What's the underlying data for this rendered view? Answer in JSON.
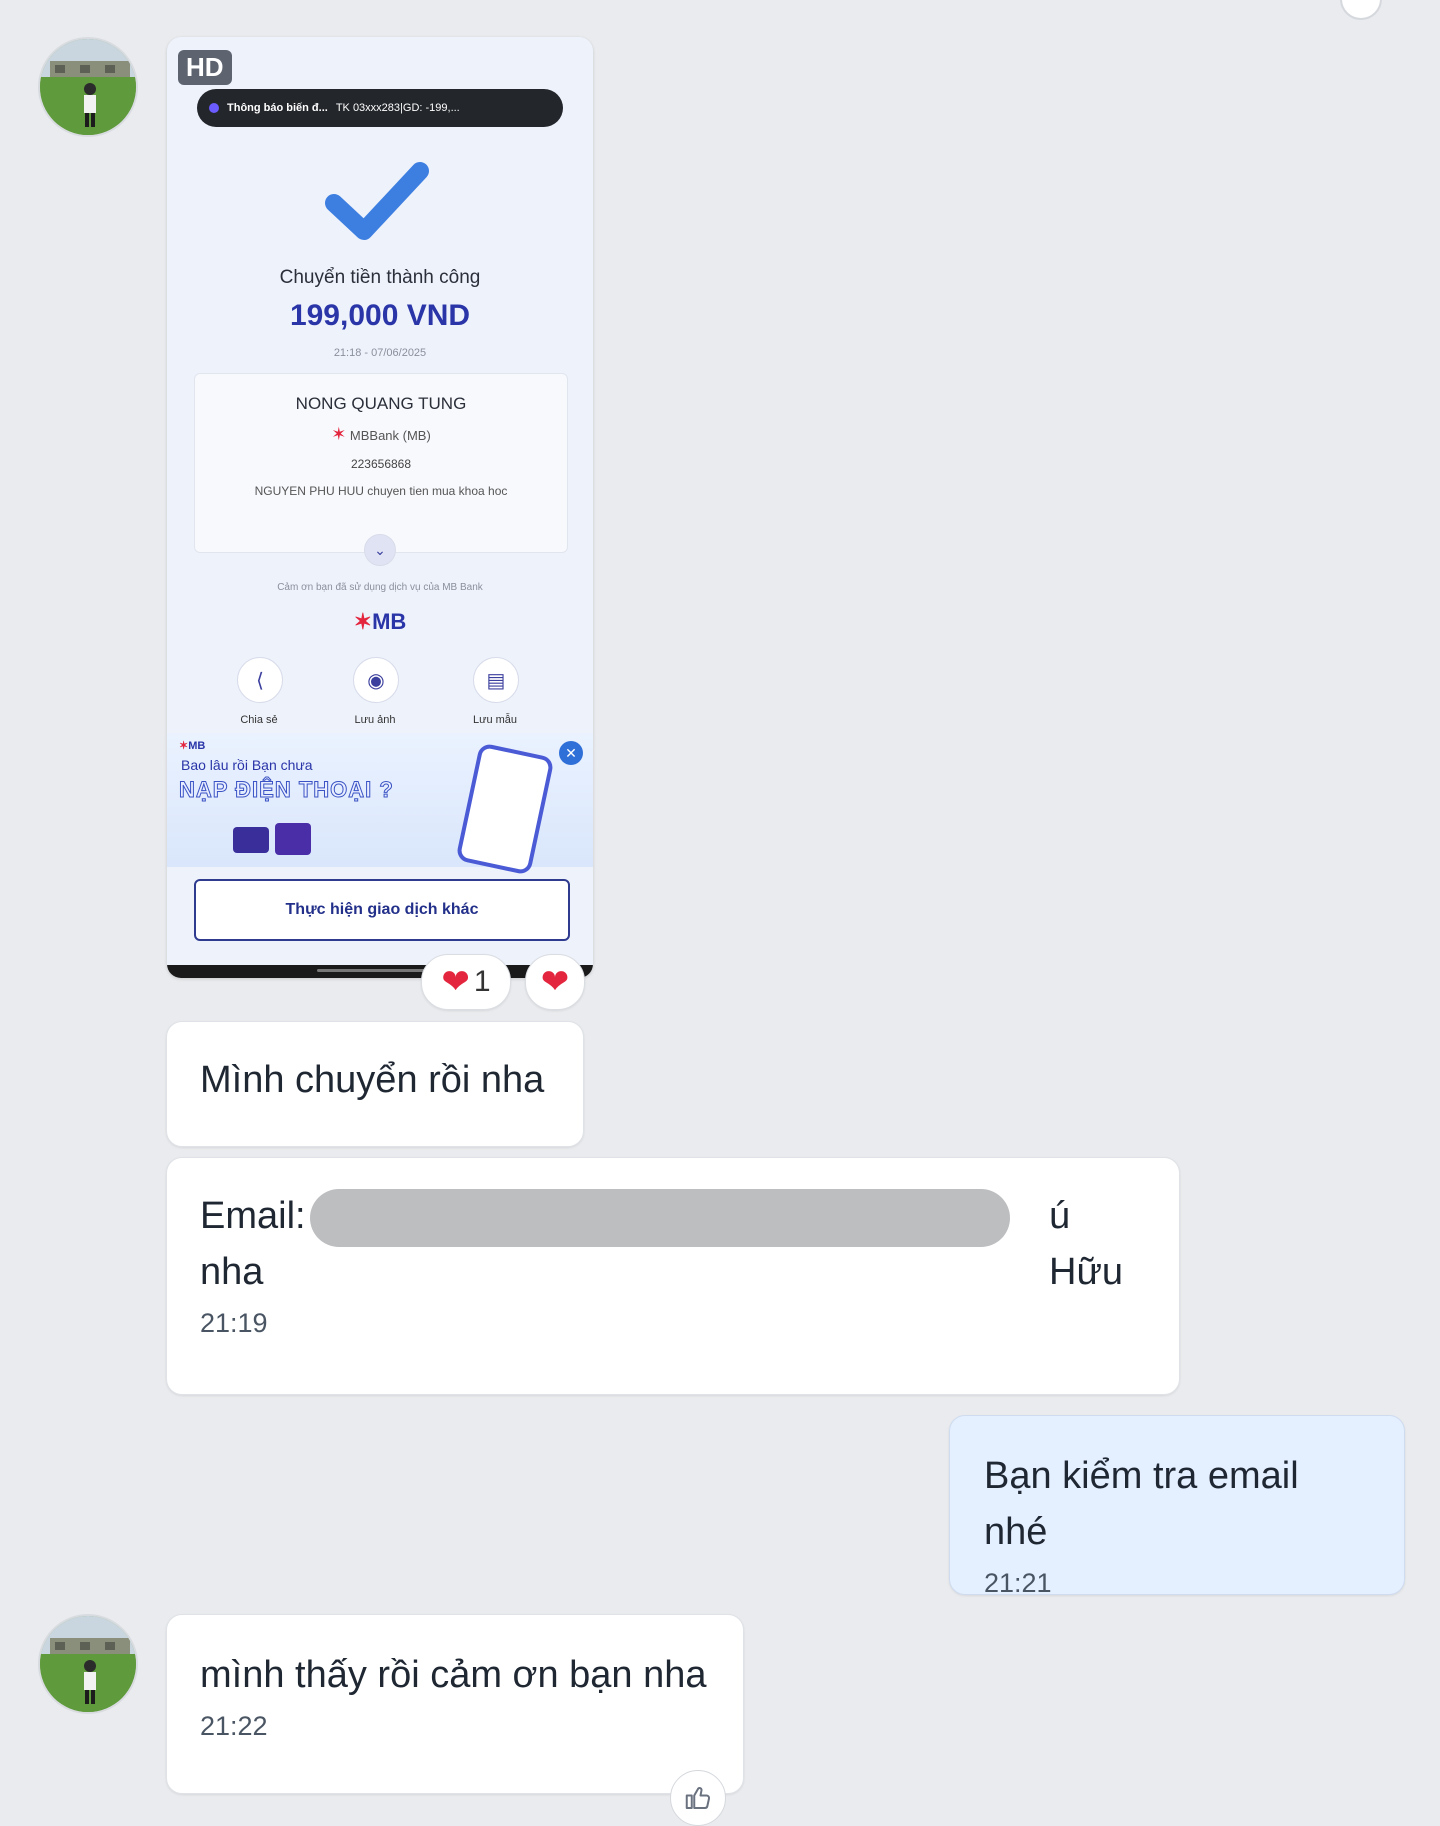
{
  "attachment": {
    "hd_badge": "HD",
    "notification_title": "Thông báo biến đ...",
    "notification_body": "TK 03xxx283|GD: -199,...",
    "success_title": "Chuyển tiền thành công",
    "amount": "199,000 VND",
    "datetime": "21:18 - 07/06/2025",
    "recipient_name": "NONG QUANG TUNG",
    "bank": "MBBank (MB)",
    "account_number": "223656868",
    "transfer_note": "NGUYEN PHU HUU chuyen tien mua khoa hoc",
    "thanks_text": "Cảm ơn bạn đã sử dụng dịch vụ của MB Bank",
    "mb_logo_text": "MB",
    "actions": [
      {
        "label": "Chia sẻ",
        "icon": "share-icon"
      },
      {
        "label": "Lưu ảnh",
        "icon": "camera-icon"
      },
      {
        "label": "Lưu mẫu",
        "icon": "template-icon"
      }
    ],
    "banner_brand": "MB",
    "banner_line1": "Bao lâu rồi Bạn chưa",
    "banner_line2": "NẠP ĐIỆN THOẠI ?",
    "other_transaction_button": "Thực hiện giao dịch khác"
  },
  "reactions": {
    "heart_count": "1"
  },
  "messages": [
    {
      "text": "Mình chuyển rồi nha",
      "time": ""
    },
    {
      "text_prefix": "Email:",
      "text_suffix": "ú Hữu",
      "text_line2": "nha",
      "time": "21:19"
    },
    {
      "text": "Bạn kiểm tra email nhé",
      "time": "21:21"
    },
    {
      "text": "mình thấy rồi cảm ơn bạn nha",
      "time": "21:22"
    }
  ],
  "colors": {
    "background": "#e9ebee",
    "incoming_bubble": "#ffffff",
    "outgoing_bubble": "#e4efff",
    "amount_blue": "#2a35a8",
    "heart_red": "#e3263e"
  }
}
